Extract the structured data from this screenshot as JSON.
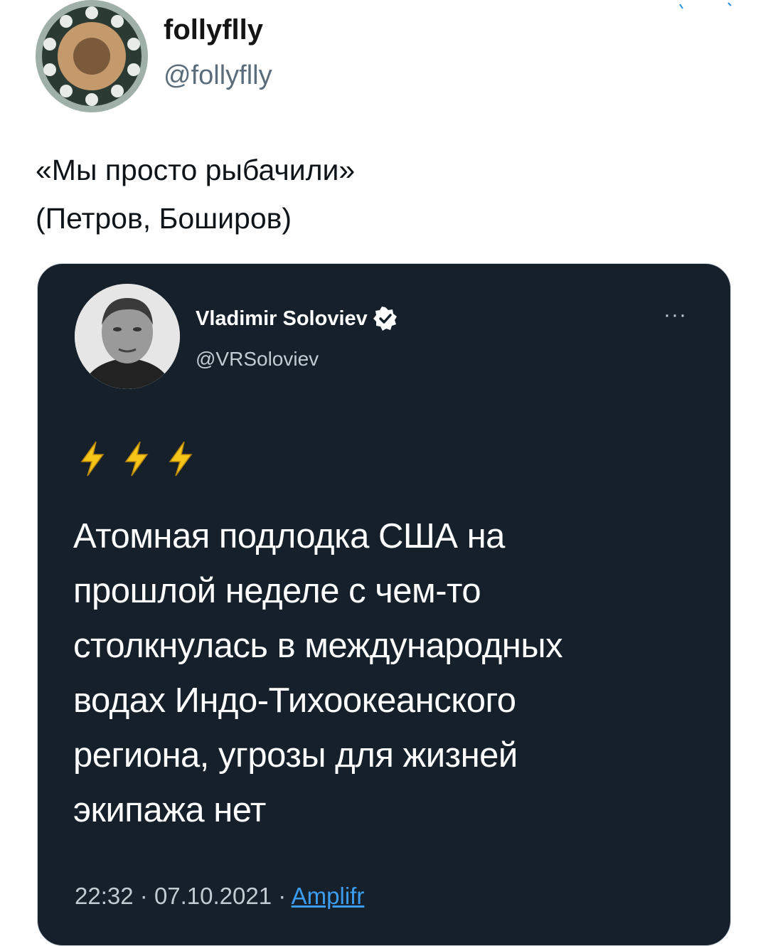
{
  "outer_tweet": {
    "display_name": "follyflly",
    "handle": "@follyflly",
    "avatar_icon": "avatar-image",
    "text_lines": [
      "«Мы просто рыбачили»",
      "(Петров, Боширов)"
    ]
  },
  "quoted_tweet": {
    "display_name": "Vladimir Soloviev",
    "handle": "@VRSoloviev",
    "verified_icon": "verified-badge-icon",
    "more_label": "···",
    "emoji_icons": [
      "lightning-icon",
      "lightning-icon",
      "lightning-icon"
    ],
    "text_lines": [
      "Атомная подлодка США на",
      "прошлой неделе с чем-то",
      "столкнулась в международных",
      "водах Индо-Тихоокеанского",
      "региона, угрозы для жизней",
      "экипажа нет"
    ],
    "time": "22:32",
    "separator": "·",
    "date": "07.10.2021",
    "source": "Amplifr"
  },
  "colors": {
    "card_background": "#15202b",
    "link": "#3b9cf0",
    "verified": "#ffffff",
    "bolt": "#f5c518"
  }
}
